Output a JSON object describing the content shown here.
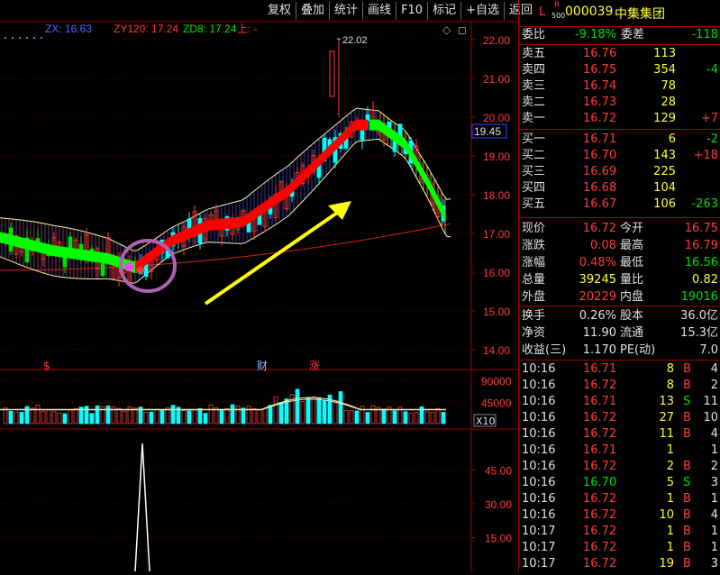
{
  "toolbar": {
    "buttons": [
      "复权",
      "叠加",
      "统计",
      "画线",
      "F10",
      "标记",
      "+自选",
      "返回"
    ]
  },
  "chart": {
    "legend": {
      "zx": "ZX: 16.63",
      "zy120": "ZY120: 17.24",
      "zd8": "ZD8: 17.24",
      "extra": "上: -"
    },
    "y_ticks": [
      "22.00",
      "21.00",
      "20.00",
      "19.00",
      "18.00",
      "17.00",
      "16.00",
      "15.00",
      "14.00"
    ],
    "high_label": "22.02",
    "cursor_price": "19.45",
    "markers": [
      "$",
      "财",
      "涨"
    ],
    "vol_ticks": [
      "90000",
      "45000"
    ],
    "vol_unit": "X10",
    "ind_ticks": [
      "45.00",
      "30.00",
      "15.00"
    ],
    "colors": {
      "up": "#ff3b3b",
      "down": "#00ffff",
      "bull": "#ff0000",
      "bear": "#00ff00",
      "arrow": "#ffff00",
      "circle": "#b060b0"
    }
  },
  "stock": {
    "r_prefix": "R",
    "l_prefix": "L",
    "index": "500",
    "code": "000039",
    "name": "中集集团"
  },
  "ratio": {
    "weibi_label": "委比",
    "weibi": "-9.18%",
    "weicha_label": "委差",
    "weicha": "-118"
  },
  "asks": [
    {
      "label": "卖五",
      "price": "16.76",
      "vol": "113",
      "chg": ""
    },
    {
      "label": "卖四",
      "price": "16.75",
      "vol": "354",
      "chg": "-4"
    },
    {
      "label": "卖三",
      "price": "16.74",
      "vol": "78",
      "chg": ""
    },
    {
      "label": "卖二",
      "price": "16.73",
      "vol": "28",
      "chg": ""
    },
    {
      "label": "卖一",
      "price": "16.72",
      "vol": "129",
      "chg": "+7"
    }
  ],
  "bids": [
    {
      "label": "买一",
      "price": "16.71",
      "vol": "6",
      "chg": "-2"
    },
    {
      "label": "买二",
      "price": "16.70",
      "vol": "143",
      "chg": "+18"
    },
    {
      "label": "买三",
      "price": "16.69",
      "vol": "225",
      "chg": ""
    },
    {
      "label": "买四",
      "price": "16.68",
      "vol": "104",
      "chg": ""
    },
    {
      "label": "买五",
      "price": "16.67",
      "vol": "106",
      "chg": "-263"
    }
  ],
  "quote": [
    {
      "l1": "现价",
      "v1": "16.72",
      "l2": "今开",
      "v2": "16.75"
    },
    {
      "l1": "涨跌",
      "v1": "0.08",
      "l2": "最高",
      "v2": "16.79"
    },
    {
      "l1": "涨幅",
      "v1": "0.48%",
      "l2": "最低",
      "v2": "16.56"
    },
    {
      "l1": "总量",
      "v1": "39245",
      "l2": "量比",
      "v2": "0.82"
    },
    {
      "l1": "外盘",
      "v1": "20229",
      "l2": "内盘",
      "v2": "19016"
    }
  ],
  "fund": [
    {
      "l1": "换手",
      "v1": "0.26%",
      "l2": "股本",
      "v2": "36.0亿"
    },
    {
      "l1": "净资",
      "v1": "11.90",
      "l2": "流通",
      "v2": "15.3亿"
    },
    {
      "l1": "收益(三)",
      "v1": "1.170",
      "l2": "PE(动)",
      "v2": "7.0"
    }
  ],
  "ticks": [
    {
      "t": "10:16",
      "p": "16.71",
      "v": "8",
      "s": "B",
      "n": "4"
    },
    {
      "t": "10:16",
      "p": "16.72",
      "v": "8",
      "s": "B",
      "n": "2"
    },
    {
      "t": "10:16",
      "p": "16.71",
      "v": "13",
      "s": "S",
      "n": "11"
    },
    {
      "t": "10:16",
      "p": "16.72",
      "v": "27",
      "s": "B",
      "n": "10"
    },
    {
      "t": "10:16",
      "p": "16.72",
      "v": "11",
      "s": "B",
      "n": "4"
    },
    {
      "t": "10:16",
      "p": "16.71",
      "v": "1",
      "s": "",
      "n": "1"
    },
    {
      "t": "10:16",
      "p": "16.72",
      "v": "2",
      "s": "B",
      "n": "2"
    },
    {
      "t": "10:16",
      "p": "16.70",
      "v": "5",
      "s": "S",
      "n": "3"
    },
    {
      "t": "10:16",
      "p": "16.72",
      "v": "1",
      "s": "B",
      "n": "1"
    },
    {
      "t": "10:16",
      "p": "16.72",
      "v": "10",
      "s": "B",
      "n": "4"
    },
    {
      "t": "10:17",
      "p": "16.72",
      "v": "1",
      "s": "B",
      "n": "1"
    },
    {
      "t": "10:17",
      "p": "16.72",
      "v": "1",
      "s": "B",
      "n": "1"
    },
    {
      "t": "10:17",
      "p": "16.72",
      "v": "19",
      "s": "B",
      "n": "3"
    }
  ]
}
